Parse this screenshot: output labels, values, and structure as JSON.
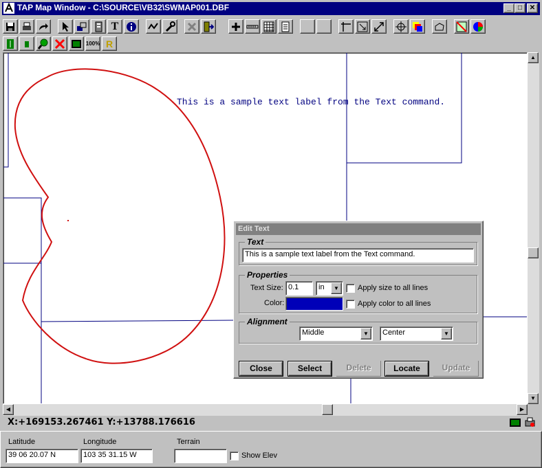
{
  "window": {
    "title": "TAP Map Window - C:\\SOURCE\\VB32\\SWMAP001.DBF",
    "minimize": "_",
    "maximize": "□",
    "close": "✕"
  },
  "colors": {
    "title_bar": "#000080",
    "map_text": "#000080",
    "boundary": "#d01010",
    "selected_color": "#0000b8",
    "disabled_title": "#808080"
  },
  "toolbar1": [
    "save-icon",
    "print-icon",
    "redo-icon",
    "pointer-icon",
    "layers-icon",
    "database-icon",
    "text-icon",
    "info-icon",
    "plot-icon",
    "tools-icon",
    "cross-icon",
    "exit-icon",
    "plus-icon",
    "ruler-icon",
    "grid-icon",
    "notepad-icon",
    "blank-icon",
    "blank-icon",
    "corner-icon",
    "zoom-box-icon",
    "zoom-extents-icon",
    "pan-icon",
    "layers-color-icon",
    "polygon-icon",
    "area-icon",
    "globe-icon"
  ],
  "toolbar2": [
    "tower-icon",
    "small-tower-icon",
    "magnifier-icon",
    "delete-x-icon",
    "screen-icon",
    "zoom-100-icon",
    "rename-icon"
  ],
  "toolbar2_text": {
    "zoom100": "100%",
    "rename": "R"
  },
  "map": {
    "label": "This is a sample text label from the Text command."
  },
  "dialog": {
    "title": "Edit Text",
    "text_group": "Text",
    "text_value": "This is a sample text label from the Text command.",
    "properties_group": "Properties",
    "text_size_label": "Text Size:",
    "text_size_value": "0.1",
    "unit_value": "in",
    "apply_size_label": "Apply size to all lines",
    "color_label": "Color:",
    "apply_color_label": "Apply color to all lines",
    "alignment_group": "Alignment",
    "vertical_align": "Middle",
    "horizontal_align": "Center",
    "buttons": {
      "close": "Close",
      "select": "Select",
      "delete": "Delete",
      "locate": "Locate",
      "update": "Update"
    }
  },
  "status": {
    "coordinates": "X:+169153.267461 Y:+13788.176616"
  },
  "bottom": {
    "latitude_label": "Latitude",
    "latitude_value": "39 06 20.07 N",
    "longitude_label": "Longitude",
    "longitude_value": "103 35 31.15 W",
    "terrain_label": "Terrain",
    "terrain_value": "",
    "show_elev_label": "Show Elev"
  }
}
